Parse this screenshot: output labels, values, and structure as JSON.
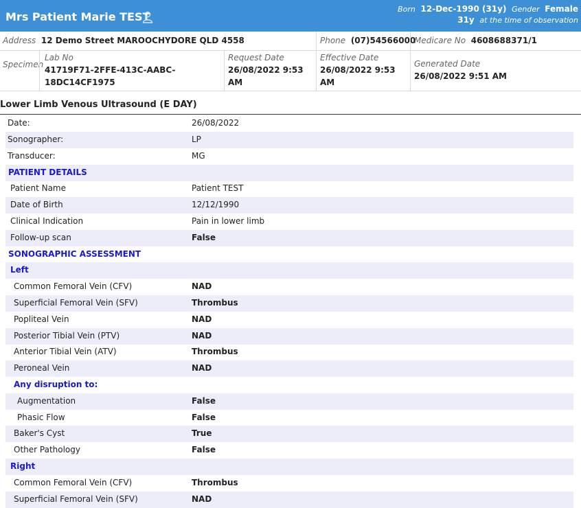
{
  "patient": {
    "name": "Mrs Patient Marie TEST",
    "icon": "person-icon",
    "born_label": "Born",
    "born_value": "12-Dec-1990 (31y)",
    "gender_label": "Gender",
    "gender_value": "Female",
    "age_value": "31y",
    "age_note": "at the time of observation"
  },
  "header": {
    "address_label": "Address",
    "address_value": "12 Demo Street MAROOCHYDORE QLD 4558",
    "phone_label": "Phone",
    "phone_value": "(07)54566000",
    "medicare_label": "Medicare No",
    "medicare_value": "4608688371/1",
    "specimen_label": "Specimen",
    "labno_label": "Lab No",
    "labno_value_line1": "41719F71-2FFE-413C-AABC-",
    "labno_value_line2": "18DC14CF1975",
    "request_label": "Request Date",
    "request_line1": "26/08/2022 9:53",
    "request_line2": "AM",
    "effective_label": "Effective Date",
    "effective_line1": "26/08/2022 9:53",
    "effective_line2": "AM",
    "generated_label": "Generated Date",
    "generated_value": "26/08/2022 9:51 AM"
  },
  "report": {
    "title": "Lower Limb Venous Ultrasound (E DAY)",
    "rows": [
      {
        "label": "Date:",
        "value": "26/08/2022"
      },
      {
        "label": "Sonographer:",
        "value": "LP"
      },
      {
        "label": "Transducer:",
        "value": "MG"
      },
      {
        "label": "PATIENT DETAILS",
        "value": ""
      },
      {
        "label": "Patient Name",
        "value": "Patient TEST"
      },
      {
        "label": "Date of Birth",
        "value": "12/12/1990"
      },
      {
        "label": "Clinical Indication",
        "value": "Pain in lower limb"
      },
      {
        "label": "Follow-up scan",
        "value": "False"
      },
      {
        "label": "SONOGRAPHIC ASSESSMENT",
        "value": ""
      },
      {
        "label": "Left",
        "value": ""
      },
      {
        "label": "Common Femoral Vein (CFV)",
        "value": "NAD"
      },
      {
        "label": "Superficial Femoral Vein (SFV)",
        "value": "Thrombus"
      },
      {
        "label": "Popliteal Vein",
        "value": "NAD"
      },
      {
        "label": "Posterior Tibial Vein (PTV)",
        "value": "NAD"
      },
      {
        "label": "Anterior Tibial Vein (ATV)",
        "value": "Thrombus"
      },
      {
        "label": "Peroneal Vein",
        "value": "NAD"
      },
      {
        "label": "Any disruption to:",
        "value": ""
      },
      {
        "label": "Augmentation",
        "value": "False"
      },
      {
        "label": "Phasic Flow",
        "value": "False"
      },
      {
        "label": "Baker's Cyst",
        "value": "True"
      },
      {
        "label": "Other Pathology",
        "value": "False"
      },
      {
        "label": "Right",
        "value": ""
      },
      {
        "label": "Common Femoral Vein (CFV)",
        "value": "Thrombus"
      },
      {
        "label": "Superficial Femoral Vein (SFV)",
        "value": "NAD"
      }
    ]
  }
}
